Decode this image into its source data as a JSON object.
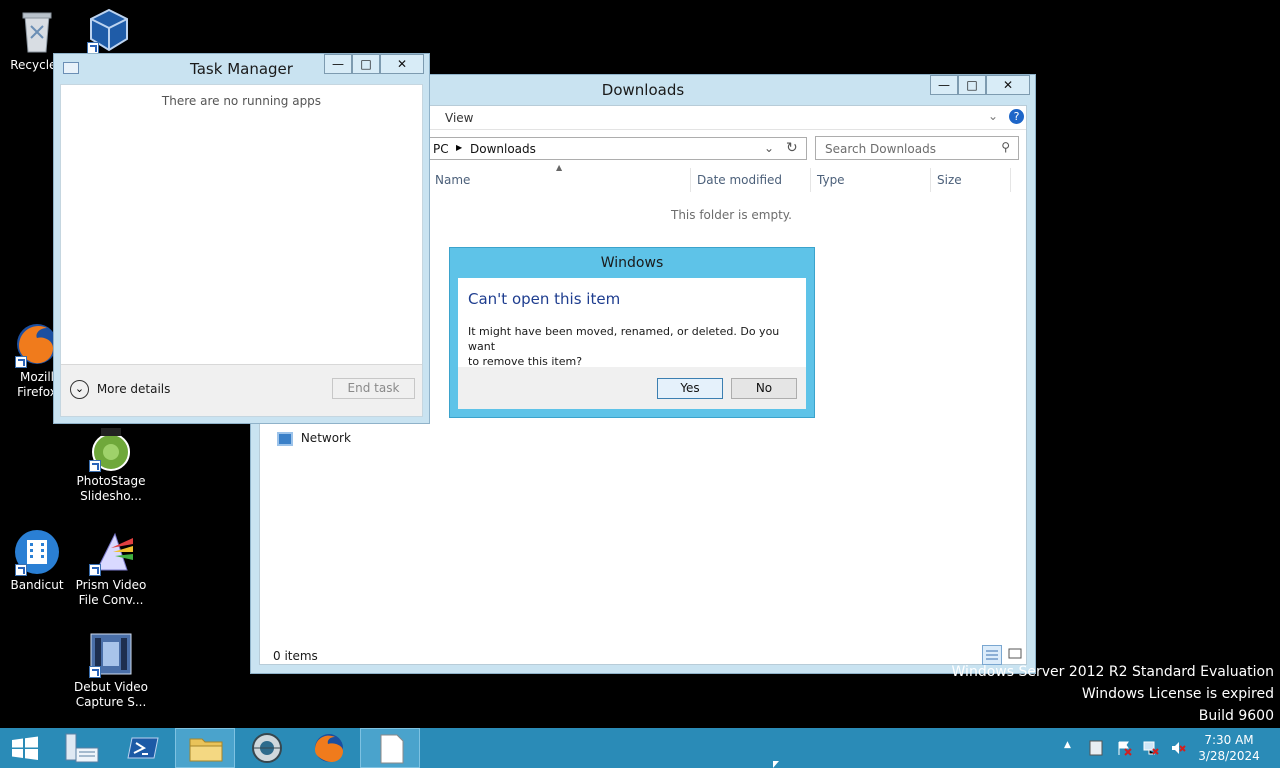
{
  "desktop": {
    "icons": [
      {
        "label": "Recycle Bin"
      },
      {
        "label": "Oracle VM VirtualBox"
      },
      {
        "label": "Mozilla Firefox"
      },
      {
        "label": "PhotoStage Slidesho..."
      },
      {
        "label": "Bandicut"
      },
      {
        "label": "Prism Video File Conv..."
      },
      {
        "label": "Debut Video Capture S..."
      }
    ],
    "recycle_label": "Recycle I",
    "firefox_label_1": "Mozill",
    "firefox_label_2": "Firefox",
    "photostage_1": "PhotoStage",
    "photostage_2": "Slidesho...",
    "bandicut": "Bandicut",
    "prism_1": "Prism Video",
    "prism_2": "File Conv...",
    "debut_1": "Debut Video",
    "debut_2": "Capture S..."
  },
  "taskmgr": {
    "title": "Task Manager",
    "message": "There are no running apps",
    "more_details": "More details",
    "end_task": "End task",
    "minimize": "—",
    "maximize": "□",
    "close": "✕"
  },
  "explorer": {
    "title": "Downloads",
    "ribbon_view": "View",
    "crumb_pc": "PC",
    "crumb_downloads": "Downloads",
    "search_placeholder": "Search Downloads",
    "columns": [
      "Name",
      "Date modified",
      "Type",
      "Size"
    ],
    "empty_message": "This folder is empty.",
    "nav_network": "Network",
    "status": "0 items",
    "minimize": "—",
    "maximize": "□",
    "close": "✕"
  },
  "dialog": {
    "title": "Windows",
    "heading": "Can't open this item",
    "body_1": "It might have been moved, renamed, or deleted. Do you want",
    "body_2": "to remove this item?",
    "yes": "Yes",
    "no": "No"
  },
  "watermark": {
    "line1": "Windows Server 2012 R2 Standard Evaluation",
    "line2": "Windows License is expired",
    "line3": "Build 9600"
  },
  "clock": {
    "time": "7:30 AM",
    "date": "3/28/2024"
  },
  "colors": {
    "taskbar": "#2a8bb7",
    "dialog_frame": "#5ec3e8",
    "window_frame": "#c9e3f1",
    "heading_blue": "#1e3d8f"
  }
}
